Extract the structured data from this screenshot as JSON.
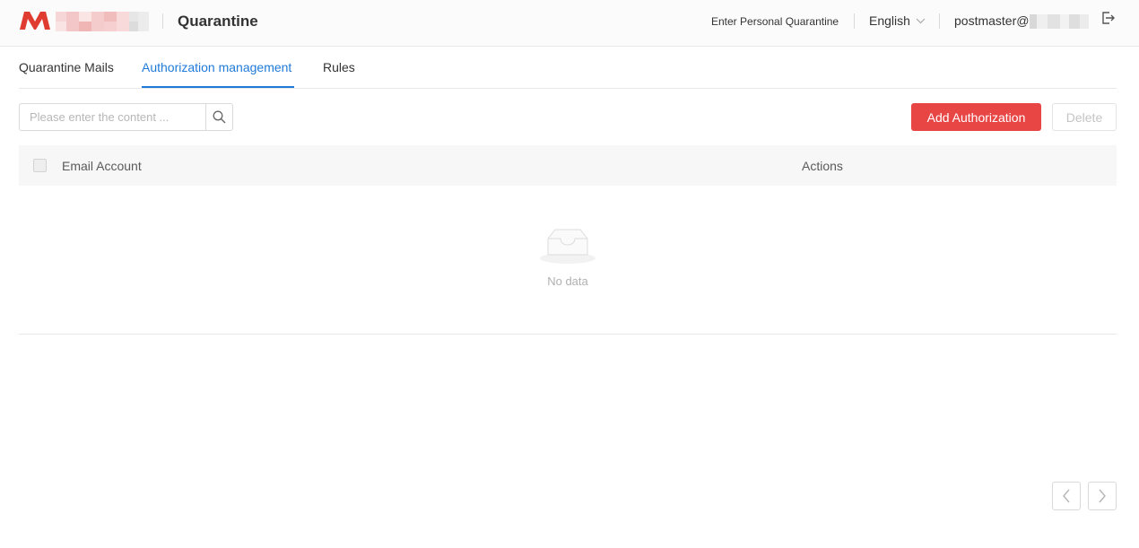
{
  "header": {
    "app_title": "Quarantine",
    "personal_link": "Enter Personal Quarantine",
    "language": "English",
    "user": "postmaster@",
    "brand_color": "#e03b31"
  },
  "tabs": [
    {
      "label": "Quarantine Mails",
      "active": false
    },
    {
      "label": "Authorization management",
      "active": true
    },
    {
      "label": "Rules",
      "active": false
    }
  ],
  "search": {
    "placeholder": "Please enter the content ...",
    "value": ""
  },
  "toolbar": {
    "add_label": "Add Authorization",
    "delete_label": "Delete",
    "add_color": "#e84545"
  },
  "table": {
    "columns": [
      "Email Account",
      "Actions"
    ],
    "rows": [],
    "empty_text": "No data"
  },
  "pagination": {
    "prev_icon": "chevron-left-icon",
    "next_icon": "chevron-right-icon"
  }
}
